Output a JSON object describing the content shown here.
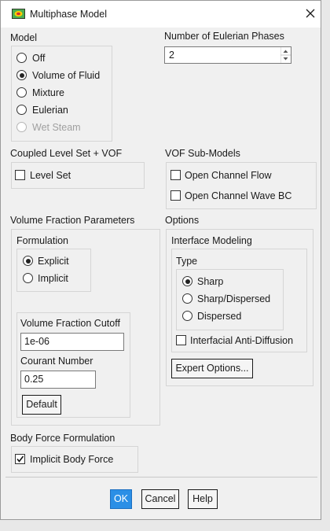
{
  "window": {
    "title": "Multiphase Model"
  },
  "model": {
    "label": "Model",
    "options": [
      {
        "label": "Off",
        "selected": false,
        "enabled": true
      },
      {
        "label": "Volume of Fluid",
        "selected": true,
        "enabled": true
      },
      {
        "label": "Mixture",
        "selected": false,
        "enabled": true
      },
      {
        "label": "Eulerian",
        "selected": false,
        "enabled": true
      },
      {
        "label": "Wet Steam",
        "selected": false,
        "enabled": false
      }
    ]
  },
  "phases": {
    "label": "Number of Eulerian Phases",
    "value": "2"
  },
  "coupled": {
    "label": "Coupled Level Set + VOF",
    "level_set": {
      "label": "Level Set",
      "checked": false
    }
  },
  "vof_submodels": {
    "label": "VOF Sub-Models",
    "open_channel_flow": {
      "label": "Open Channel Flow",
      "checked": false
    },
    "open_channel_wave_bc": {
      "label": "Open Channel Wave BC",
      "checked": false
    }
  },
  "vfp": {
    "label": "Volume Fraction Parameters",
    "formulation": {
      "label": "Formulation",
      "options": [
        {
          "label": "Explicit",
          "selected": true
        },
        {
          "label": "Implicit",
          "selected": false
        }
      ]
    },
    "cutoff": {
      "label": "Volume Fraction Cutoff",
      "value": "1e-06"
    },
    "courant": {
      "label": "Courant Number",
      "value": "0.25"
    },
    "default_button": "Default"
  },
  "options": {
    "label": "Options",
    "interface_modeling": {
      "label": "Interface Modeling",
      "type_label": "Type",
      "types": [
        {
          "label": "Sharp",
          "selected": true
        },
        {
          "label": "Sharp/Dispersed",
          "selected": false
        },
        {
          "label": "Dispersed",
          "selected": false
        }
      ],
      "anti_diffusion": {
        "label": "Interfacial Anti-Diffusion",
        "checked": false
      }
    },
    "expert_button": "Expert Options..."
  },
  "body_force": {
    "label": "Body Force Formulation",
    "implicit": {
      "label": "Implicit Body Force",
      "checked": true
    }
  },
  "buttons": {
    "ok": "OK",
    "cancel": "Cancel",
    "help": "Help"
  },
  "colors": {
    "accent": "#2b8fe6",
    "window_bg": "#f0f0f0"
  }
}
